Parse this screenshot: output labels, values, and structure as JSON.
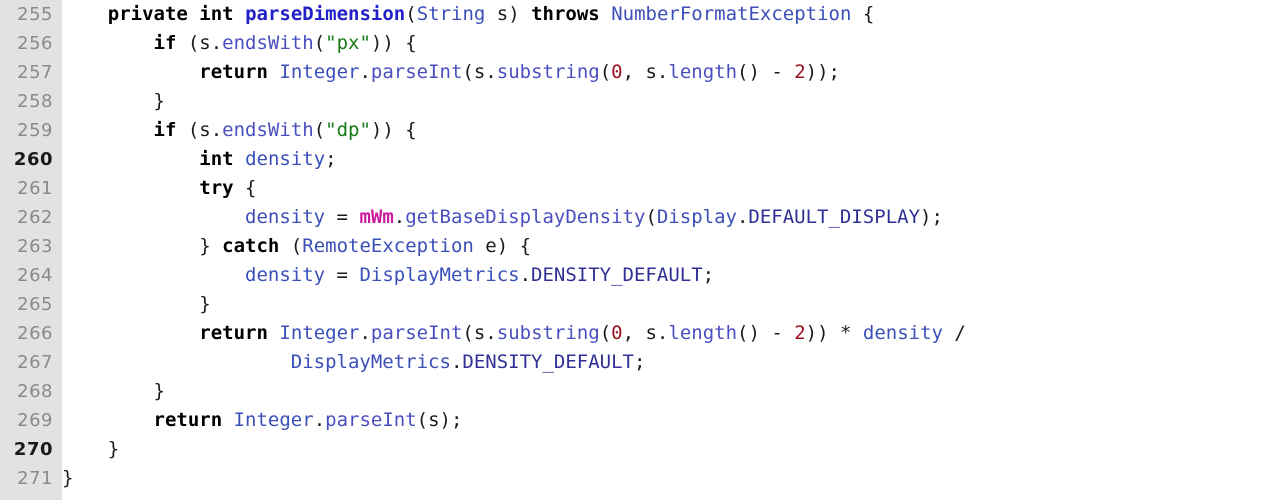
{
  "editor": {
    "kind": "source-code-view",
    "language": "Java",
    "first_line": 255,
    "last_line": 271,
    "background": "#ffffff",
    "gutter_background": "#e2e2e2",
    "gutter_text_color": "#8a8a8a",
    "highlighted_line_numbers": [
      260,
      270
    ]
  },
  "palette": {
    "plain": "#1b1b1b",
    "keyword": "#000000",
    "type": "#3b4fb8",
    "method": "#4a4fc0",
    "declaration": "#2121c7",
    "string": "#177a17",
    "number": "#9b1222",
    "field": "#cc1a9e",
    "constant": "#2f2f96"
  },
  "lines": [
    {
      "number": "255",
      "bold_number": false,
      "tokens": [
        {
          "t": "    ",
          "c": "plain"
        },
        {
          "t": "private",
          "c": "kw"
        },
        {
          "t": " ",
          "c": "plain"
        },
        {
          "t": "int",
          "c": "kw"
        },
        {
          "t": " ",
          "c": "plain"
        },
        {
          "t": "parseDimension",
          "c": "fn"
        },
        {
          "t": "(",
          "c": "plain"
        },
        {
          "t": "String",
          "c": "type"
        },
        {
          "t": " s) ",
          "c": "plain"
        },
        {
          "t": "throws",
          "c": "kw"
        },
        {
          "t": " ",
          "c": "plain"
        },
        {
          "t": "NumberFormatException",
          "c": "type"
        },
        {
          "t": " {",
          "c": "plain"
        }
      ]
    },
    {
      "number": "256",
      "bold_number": false,
      "tokens": [
        {
          "t": "        ",
          "c": "plain"
        },
        {
          "t": "if",
          "c": "kw"
        },
        {
          "t": " (s.",
          "c": "plain"
        },
        {
          "t": "endsWith",
          "c": "mth"
        },
        {
          "t": "(",
          "c": "plain"
        },
        {
          "t": "\"px\"",
          "c": "str"
        },
        {
          "t": ")) {",
          "c": "plain"
        }
      ]
    },
    {
      "number": "257",
      "bold_number": false,
      "tokens": [
        {
          "t": "            ",
          "c": "plain"
        },
        {
          "t": "return",
          "c": "kw"
        },
        {
          "t": " ",
          "c": "plain"
        },
        {
          "t": "Integer",
          "c": "type"
        },
        {
          "t": ".",
          "c": "plain"
        },
        {
          "t": "parseInt",
          "c": "mth"
        },
        {
          "t": "(s.",
          "c": "plain"
        },
        {
          "t": "substring",
          "c": "mth"
        },
        {
          "t": "(",
          "c": "plain"
        },
        {
          "t": "0",
          "c": "num"
        },
        {
          "t": ", s.",
          "c": "plain"
        },
        {
          "t": "length",
          "c": "mth"
        },
        {
          "t": "() - ",
          "c": "plain"
        },
        {
          "t": "2",
          "c": "num"
        },
        {
          "t": "));",
          "c": "plain"
        }
      ]
    },
    {
      "number": "258",
      "bold_number": false,
      "tokens": [
        {
          "t": "        }",
          "c": "plain"
        }
      ]
    },
    {
      "number": "259",
      "bold_number": false,
      "tokens": [
        {
          "t": "        ",
          "c": "plain"
        },
        {
          "t": "if",
          "c": "kw"
        },
        {
          "t": " (s.",
          "c": "plain"
        },
        {
          "t": "endsWith",
          "c": "mth"
        },
        {
          "t": "(",
          "c": "plain"
        },
        {
          "t": "\"dp\"",
          "c": "str"
        },
        {
          "t": ")) {",
          "c": "plain"
        }
      ]
    },
    {
      "number": "260",
      "bold_number": true,
      "tokens": [
        {
          "t": "            ",
          "c": "plain"
        },
        {
          "t": "int",
          "c": "kw"
        },
        {
          "t": " ",
          "c": "plain"
        },
        {
          "t": "density",
          "c": "type"
        },
        {
          "t": ";",
          "c": "plain"
        }
      ]
    },
    {
      "number": "261",
      "bold_number": false,
      "tokens": [
        {
          "t": "            ",
          "c": "plain"
        },
        {
          "t": "try",
          "c": "kw"
        },
        {
          "t": " {",
          "c": "plain"
        }
      ]
    },
    {
      "number": "262",
      "bold_number": false,
      "tokens": [
        {
          "t": "                ",
          "c": "plain"
        },
        {
          "t": "density",
          "c": "type"
        },
        {
          "t": " = ",
          "c": "plain"
        },
        {
          "t": "mWm",
          "c": "fld"
        },
        {
          "t": ".",
          "c": "plain"
        },
        {
          "t": "getBaseDisplayDensity",
          "c": "mth"
        },
        {
          "t": "(",
          "c": "plain"
        },
        {
          "t": "Display",
          "c": "type"
        },
        {
          "t": ".",
          "c": "plain"
        },
        {
          "t": "DEFAULT_DISPLAY",
          "c": "const"
        },
        {
          "t": ");",
          "c": "plain"
        }
      ]
    },
    {
      "number": "263",
      "bold_number": false,
      "tokens": [
        {
          "t": "            } ",
          "c": "plain"
        },
        {
          "t": "catch",
          "c": "kw"
        },
        {
          "t": " (",
          "c": "plain"
        },
        {
          "t": "RemoteException",
          "c": "type"
        },
        {
          "t": " e) {",
          "c": "plain"
        }
      ]
    },
    {
      "number": "264",
      "bold_number": false,
      "tokens": [
        {
          "t": "                ",
          "c": "plain"
        },
        {
          "t": "density",
          "c": "type"
        },
        {
          "t": " = ",
          "c": "plain"
        },
        {
          "t": "DisplayMetrics",
          "c": "type"
        },
        {
          "t": ".",
          "c": "plain"
        },
        {
          "t": "DENSITY_DEFAULT",
          "c": "const"
        },
        {
          "t": ";",
          "c": "plain"
        }
      ]
    },
    {
      "number": "265",
      "bold_number": false,
      "tokens": [
        {
          "t": "            }",
          "c": "plain"
        }
      ]
    },
    {
      "number": "266",
      "bold_number": false,
      "tokens": [
        {
          "t": "            ",
          "c": "plain"
        },
        {
          "t": "return",
          "c": "kw"
        },
        {
          "t": " ",
          "c": "plain"
        },
        {
          "t": "Integer",
          "c": "type"
        },
        {
          "t": ".",
          "c": "plain"
        },
        {
          "t": "parseInt",
          "c": "mth"
        },
        {
          "t": "(s.",
          "c": "plain"
        },
        {
          "t": "substring",
          "c": "mth"
        },
        {
          "t": "(",
          "c": "plain"
        },
        {
          "t": "0",
          "c": "num"
        },
        {
          "t": ", s.",
          "c": "plain"
        },
        {
          "t": "length",
          "c": "mth"
        },
        {
          "t": "() - ",
          "c": "plain"
        },
        {
          "t": "2",
          "c": "num"
        },
        {
          "t": ")) * ",
          "c": "plain"
        },
        {
          "t": "density",
          "c": "type"
        },
        {
          "t": " /",
          "c": "plain"
        }
      ]
    },
    {
      "number": "267",
      "bold_number": false,
      "tokens": [
        {
          "t": "                    ",
          "c": "plain"
        },
        {
          "t": "DisplayMetrics",
          "c": "type"
        },
        {
          "t": ".",
          "c": "plain"
        },
        {
          "t": "DENSITY_DEFAULT",
          "c": "const"
        },
        {
          "t": ";",
          "c": "plain"
        }
      ]
    },
    {
      "number": "268",
      "bold_number": false,
      "tokens": [
        {
          "t": "        }",
          "c": "plain"
        }
      ]
    },
    {
      "number": "269",
      "bold_number": false,
      "tokens": [
        {
          "t": "        ",
          "c": "plain"
        },
        {
          "t": "return",
          "c": "kw"
        },
        {
          "t": " ",
          "c": "plain"
        },
        {
          "t": "Integer",
          "c": "type"
        },
        {
          "t": ".",
          "c": "plain"
        },
        {
          "t": "parseInt",
          "c": "mth"
        },
        {
          "t": "(s);",
          "c": "plain"
        }
      ]
    },
    {
      "number": "270",
      "bold_number": true,
      "tokens": [
        {
          "t": "    }",
          "c": "plain"
        }
      ]
    },
    {
      "number": "271",
      "bold_number": false,
      "tokens": [
        {
          "t": "}",
          "c": "plain"
        }
      ]
    }
  ]
}
